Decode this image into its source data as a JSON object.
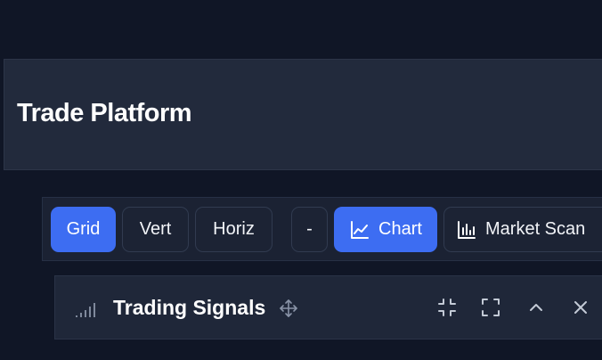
{
  "header": {
    "title": "Trade Platform"
  },
  "toolbar": {
    "grid_label": "Grid",
    "vert_label": "Vert",
    "horiz_label": "Horiz",
    "minus_label": "-",
    "chart_label": "Chart",
    "market_scan_label": "Market Scan",
    "active_layout": "Grid",
    "active_view": "Chart"
  },
  "panel": {
    "title": "Trading Signals",
    "icon": "signal-bars-icon",
    "controls": [
      "collapse-icon",
      "expand-icon",
      "chevron-up-icon",
      "close-icon"
    ]
  },
  "colors": {
    "background": "#101626",
    "header": "#222a3c",
    "accent": "#3d6df2",
    "text": "#ffffff",
    "muted": "#8a94a8"
  }
}
